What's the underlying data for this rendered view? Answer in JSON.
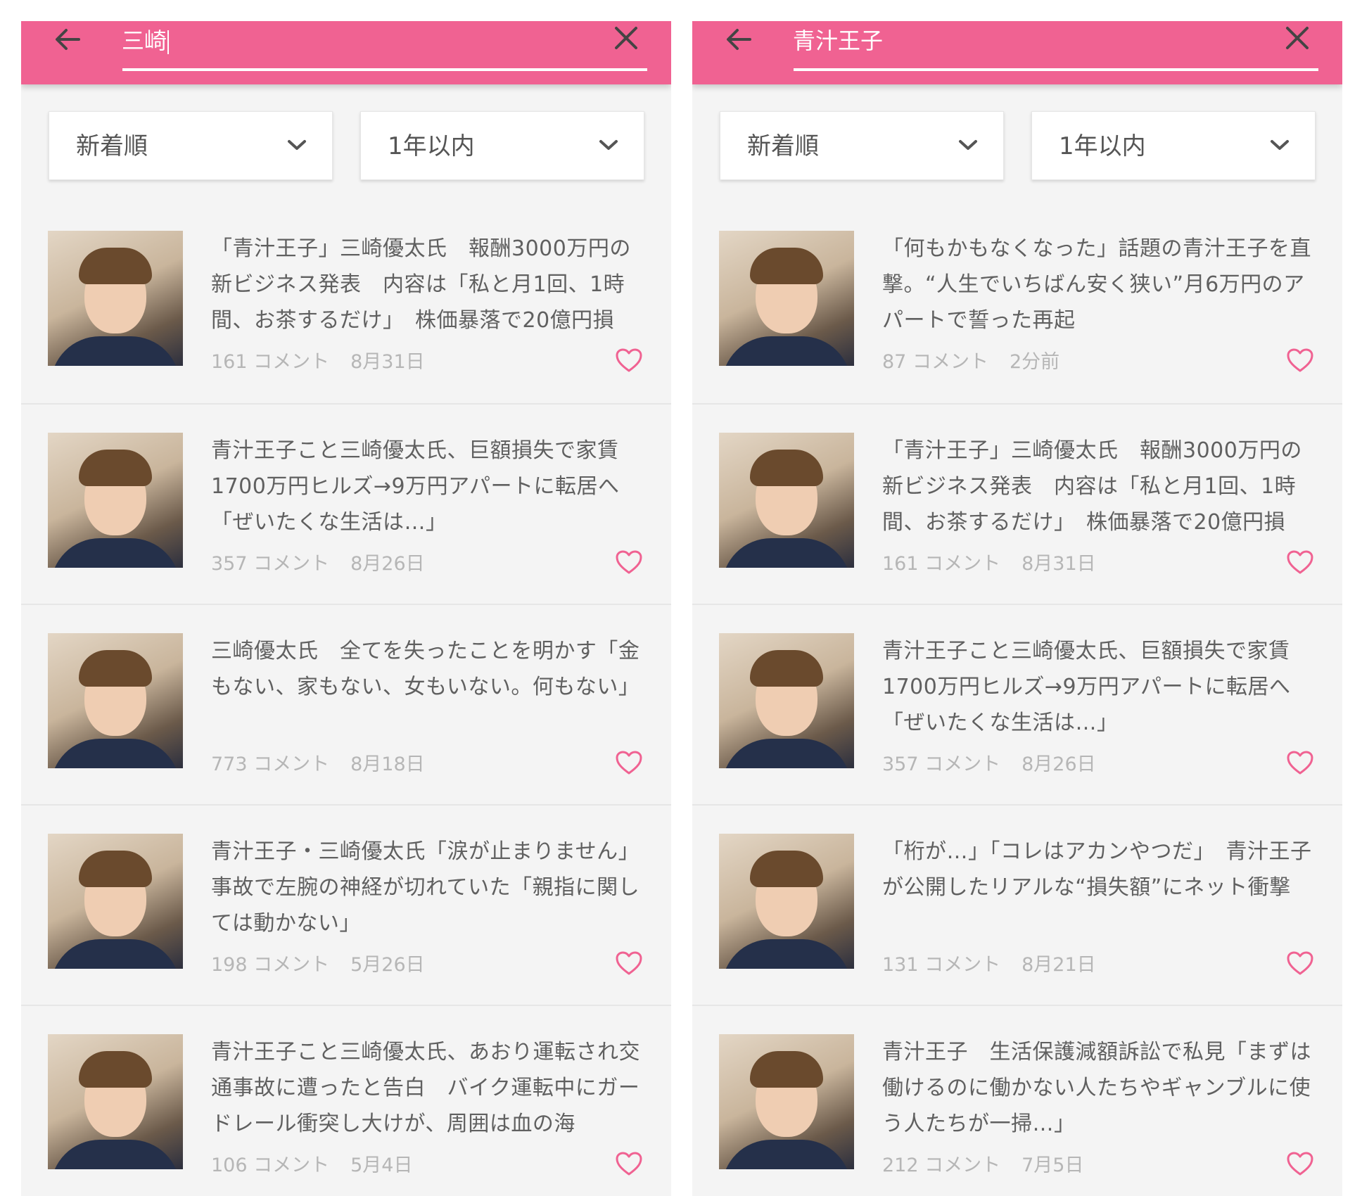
{
  "theme": {
    "accent": "#f06292",
    "heart": "#f06292"
  },
  "icons": {
    "back": "arrow-left",
    "close": "x-mark",
    "dropdown": "chevron-down",
    "like": "heart-outline"
  },
  "left": {
    "search_value": "三崎",
    "sort_label": "新着順",
    "period_label": "1年以内",
    "articles": [
      {
        "title": "「青汁王子」三崎優太氏　報酬3000万円の新ビジネス発表　内容は「私と月1回、1時間、お茶するだけ」　株価暴落で20億円損",
        "comments": "161 コメント",
        "date": "8月31日"
      },
      {
        "title": "青汁王子こと三崎優太氏、巨額損失で家賃1700万円ヒルズ→9万円アパートに転居へ「ぜいたくな生活は…」",
        "comments": "357 コメント",
        "date": "8月26日"
      },
      {
        "title": "三崎優太氏　全てを失ったことを明かす「金もない、家もない、女もいない。何もない」",
        "comments": "773 コメント",
        "date": "8月18日"
      },
      {
        "title": "青汁王子・三崎優太氏「涙が止まりません」 事故で左腕の神経が切れていた「親指に関しては動かない」",
        "comments": "198 コメント",
        "date": "5月26日"
      },
      {
        "title": "青汁王子こと三崎優太氏、あおり運転され交通事故に遭ったと告白　バイク運転中にガードレール衝突し大けが、周囲は血の海",
        "comments": "106 コメント",
        "date": "5月4日"
      }
    ]
  },
  "right": {
    "search_value": "青汁王子",
    "sort_label": "新着順",
    "period_label": "1年以内",
    "articles": [
      {
        "title": "「何もかもなくなった」話題の青汁王子を直撃。“人生でいちばん安く狭い”月6万円のアパートで誓った再起",
        "comments": "87 コメント",
        "date": "2分前"
      },
      {
        "title": "「青汁王子」三崎優太氏　報酬3000万円の新ビジネス発表　内容は「私と月1回、1時間、お茶するだけ」　株価暴落で20億円損",
        "comments": "161 コメント",
        "date": "8月31日"
      },
      {
        "title": "青汁王子こと三崎優太氏、巨額損失で家賃1700万円ヒルズ→9万円アパートに転居へ「ぜいたくな生活は…」",
        "comments": "357 コメント",
        "date": "8月26日"
      },
      {
        "title": "「桁が…」「コレはアカンやつだ」　青汁王子が公開したリアルな“損失額”にネット衝撃",
        "comments": "131 コメント",
        "date": "8月21日"
      },
      {
        "title": "青汁王子　生活保護減額訴訟で私見「まずは働けるのに働かない人たちやギャンブルに使う人たちが一掃…」",
        "comments": "212 コメント",
        "date": "7月5日"
      }
    ]
  }
}
